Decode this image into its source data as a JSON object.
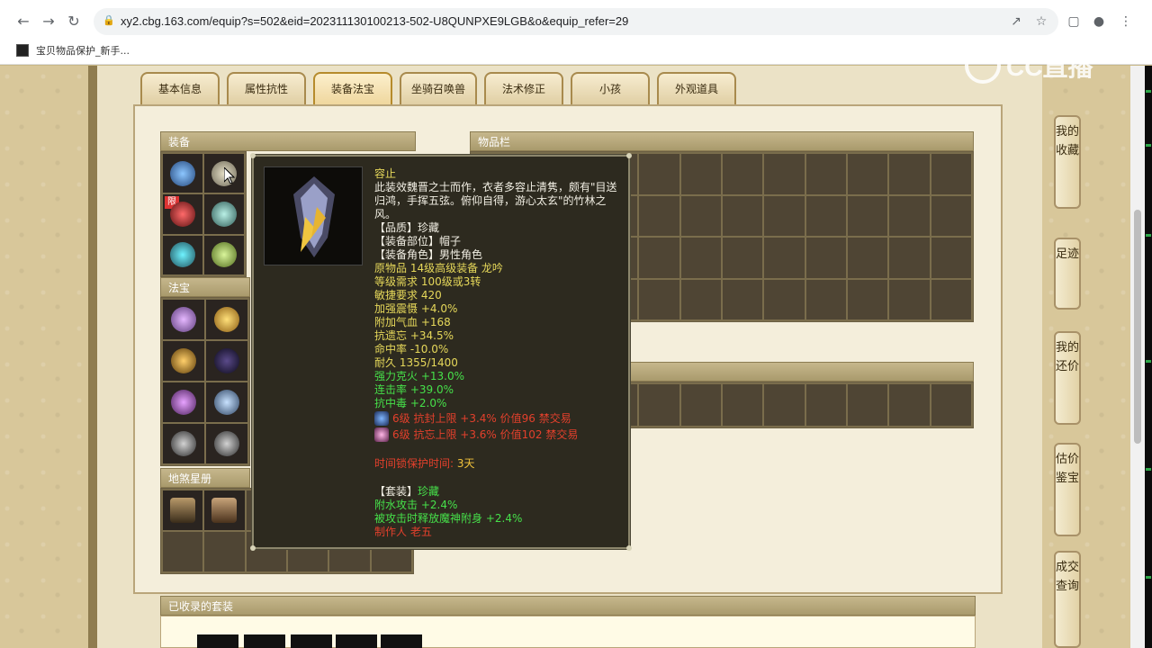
{
  "browser": {
    "url": "xy2.cbg.163.com/equip?s=502&eid=202311130100213-502-U8QUNPXE9LGB&o&equip_refer=29",
    "bookmark_label": "宝贝物品保护_新手..."
  },
  "watermark": {
    "text": "CC直播"
  },
  "tabs": [
    {
      "label": "基本信息"
    },
    {
      "label": "属性抗性"
    },
    {
      "label": "装备法宝"
    },
    {
      "label": "坐骑召唤兽"
    },
    {
      "label": "法术修正"
    },
    {
      "label": "小孩"
    },
    {
      "label": "外观道具"
    }
  ],
  "panels": {
    "equipment": "装备",
    "treasure": "法宝",
    "star_book": "地煞星册",
    "inventory": "物品栏",
    "collected_sets": "已收录的套装"
  },
  "equipment_badge": "限",
  "sidebar": [
    "我的收藏",
    "足迹",
    "我的还价",
    "估价鉴宝",
    "成交查询"
  ],
  "tooltip": {
    "name": "容止",
    "desc": "此装效魏晋之士而作，衣者多容止清隽，颇有\"目送归鸿，手挥五弦。俯仰自得，游心太玄\"的竹林之风。",
    "quality": "【品质】珍藏",
    "slot": "【装备部位】帽子",
    "role": "【装备角色】男性角色",
    "origin": "原物品 14级高级装备 龙吟",
    "level_req": "等级需求 100级或3转",
    "agi_req": "敏捷要求 420",
    "stat1": "加强震慑 +4.0%",
    "stat2": "附加气血 +168",
    "stat3": "抗遗忘 +34.5%",
    "stat4": "命中率 -10.0%",
    "durability": "耐久 1355/1400",
    "green1": "强力克火 +13.0%",
    "green2": "连击率 +39.0%",
    "green3": "抗中毒 +2.0%",
    "gem1": "6级 抗封上限 +3.4% 价值96 禁交易",
    "gem2": "6级 抗忘上限 +3.6% 价值102 禁交易",
    "protect_label": "时间锁保护时间:",
    "protect_value": "3天",
    "set_label": "【套装】",
    "set_value": "珍藏",
    "set1": "附水攻击 +2.4%",
    "set2": "被攻击时释放魔神附身 +2.4%",
    "maker": "制作人 老五"
  },
  "colors": {
    "tooltip_bg": "#2d2a1f",
    "yellow": "#e6d85a",
    "green": "#46e04a",
    "red": "#e3402c"
  }
}
